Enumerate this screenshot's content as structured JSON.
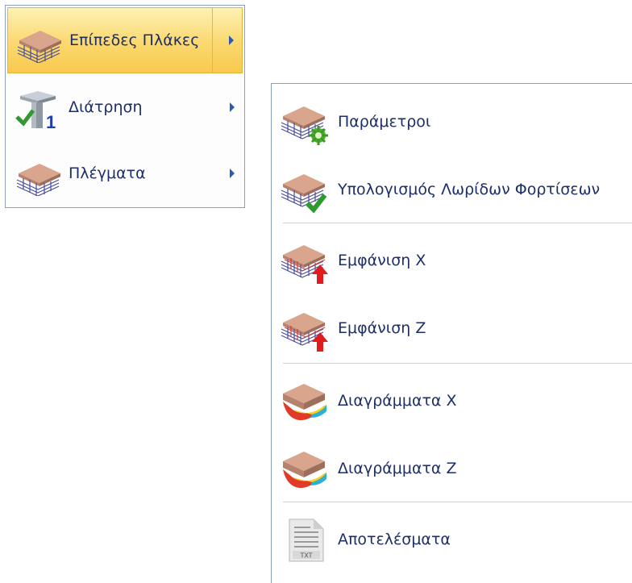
{
  "main_menu": {
    "items": [
      {
        "label": "Επίπεδες Πλάκες",
        "icon": "slab-mesh-icon",
        "highlighted": true
      },
      {
        "label": "Διάτρηση",
        "icon": "column-punching-icon",
        "highlighted": false
      },
      {
        "label": "Πλέγματα",
        "icon": "slab-mesh-icon",
        "highlighted": false
      }
    ]
  },
  "sub_menu": {
    "items": [
      {
        "label": "Παράμετροι",
        "icon": "slab-settings-icon"
      },
      {
        "label": "Υπολογισμός Λωρίδων Φορτίσεων",
        "icon": "slab-check-icon"
      },
      {
        "label": "Εμφάνιση X",
        "icon": "slab-red-arrow-icon"
      },
      {
        "label": "Εμφάνιση Z",
        "icon": "slab-red-arrow-icon"
      },
      {
        "label": "Διαγράμματα X",
        "icon": "slab-diagram-icon"
      },
      {
        "label": "Διαγράμματα Z",
        "icon": "slab-diagram-icon"
      },
      {
        "label": "Αποτελέσματα",
        "icon": "txt-document-icon"
      }
    ]
  },
  "txt_icon_text": "TXT",
  "colors": {
    "highlight": "#f9cf5a",
    "text": "#1d2f66",
    "arrow": "#2a5ab8",
    "border": "#8aa0c0"
  }
}
